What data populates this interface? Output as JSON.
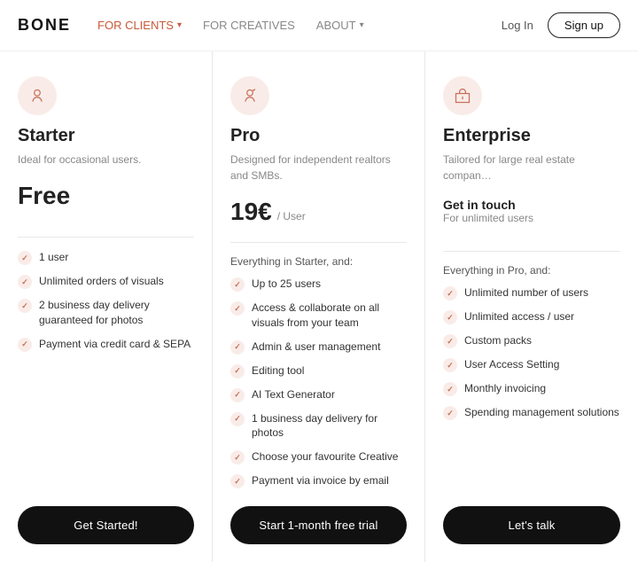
{
  "nav": {
    "logo": "BONE",
    "links": [
      {
        "label": "FOR CLIENTS",
        "hasChevron": true,
        "active": true
      },
      {
        "label": "FOR CREATIVES",
        "hasChevron": false,
        "active": false
      },
      {
        "label": "ABOUT",
        "hasChevron": true,
        "active": false
      }
    ],
    "login_label": "Log In",
    "signup_label": "Sign up"
  },
  "plans": [
    {
      "id": "starter",
      "name": "Starter",
      "desc": "Ideal for occasional users.",
      "price_type": "free",
      "price_label": "Free",
      "features_header": null,
      "features": [
        "1 user",
        "Unlimited orders of visuals",
        "2 business day delivery guaranteed for photos",
        "Payment via credit card & SEPA"
      ],
      "cta": "Get Started!"
    },
    {
      "id": "pro",
      "name": "Pro",
      "desc": "Designed for independent realtors and SMBs.",
      "price_type": "paid",
      "price_amount": "19€",
      "price_per": "/ User",
      "features_header": "Everything in Starter, and:",
      "features": [
        "Up to 25 users",
        "Access & collaborate on all visuals from your team",
        "Admin & user management",
        "Editing tool",
        "AI Text Generator",
        "1 business day delivery for photos",
        "Choose your favourite Creative",
        "Payment via invoice by email"
      ],
      "cta": "Start 1-month free trial"
    },
    {
      "id": "enterprise",
      "name": "Enterprise",
      "desc": "Tailored for large real estate compan…",
      "price_type": "contact",
      "contact_label": "Get in touch",
      "contact_sub": "For unlimited users",
      "features_header": "Everything in Pro, and:",
      "features": [
        "Unlimited number of users",
        "Unlimited access / user",
        "Custom packs",
        "User Access Setting",
        "Monthly invoicing",
        "Spending management solutions"
      ],
      "cta": "Let's talk"
    }
  ]
}
